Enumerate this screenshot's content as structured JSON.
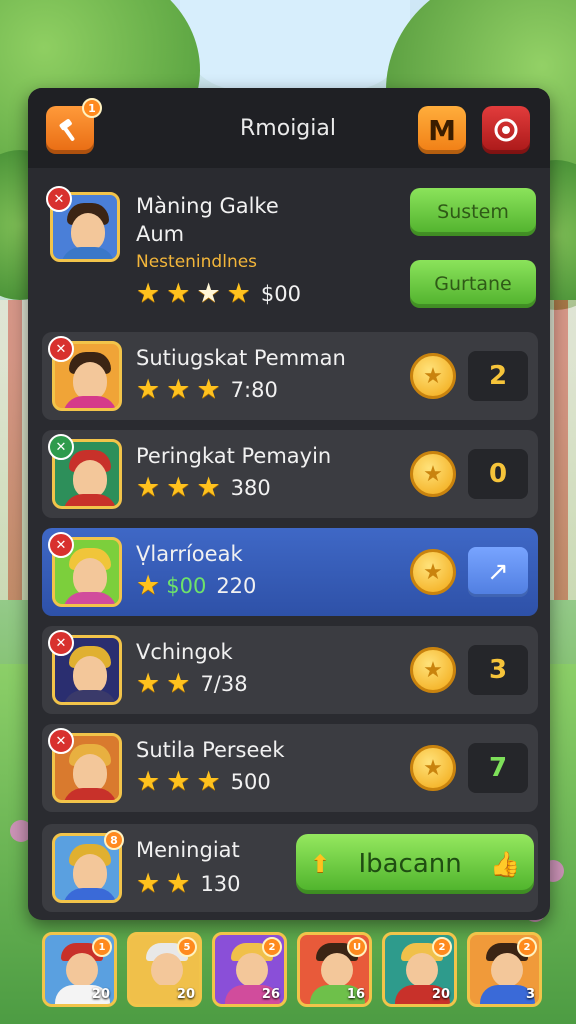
{
  "header": {
    "title": "Rmoigial",
    "left_icon": "hammer-icon",
    "left_badge": "1",
    "m_label": "M",
    "close_icon": "target-icon"
  },
  "top_player": {
    "name_line1": "Màning Galke",
    "name_line2": "Aum",
    "subtitle": "Nestenindlnes",
    "stars": 4,
    "score": "$00",
    "buttons": [
      "Sustem",
      "Gurtane"
    ]
  },
  "rows": [
    {
      "name": "Sutiugskat Pemman",
      "stars": 3,
      "score": "7:80",
      "count": "2",
      "count_color": "#f6c43a",
      "avatar_bg": "#f0a437",
      "hair": "#3b2414",
      "shirt": "#d53a8a",
      "highlight": false
    },
    {
      "name": "Peringkat Pemayin",
      "stars": 3,
      "score": "380",
      "count": "0",
      "count_color": "#f6c43a",
      "avatar_bg": "#2d8f5a",
      "hair": "#c8312a",
      "shirt": "#c8312a",
      "highlight": false
    },
    {
      "name": "Ṿlarríoeak",
      "stars": 1,
      "money": "$00",
      "score": "220",
      "count": "↗",
      "count_color": "#ffffff",
      "avatar_bg": "#7ccf3c",
      "hair": "#f0c53a",
      "shirt": "#d14c9c",
      "highlight": true
    },
    {
      "name": "Vchingok",
      "stars": 2,
      "score": "7/38",
      "count": "3",
      "count_color": "#f6c43a",
      "avatar_bg": "#2a2e70",
      "hair": "#e0b030",
      "shirt": "#3a3a6a",
      "highlight": false
    },
    {
      "name": "Sutila  Perseek",
      "stars": 3,
      "score": "500",
      "count": "7",
      "count_color": "#7ee05a",
      "avatar_bg": "#d97a2e",
      "hair": "#e8b040",
      "shirt": "#c8312a",
      "highlight": false
    }
  ],
  "bottom_player": {
    "name": "Meningiat",
    "stars": 2,
    "score": "130",
    "button_label": "Ibacann",
    "badge": "8"
  },
  "strip": [
    {
      "level": "20",
      "badge": "1",
      "bg": "#5aa0e0",
      "hat": "#c8312a",
      "shirt": "#f4f4f4"
    },
    {
      "level": "20",
      "badge": "5",
      "bg": "#f0c04a",
      "hat": "#e8e8e8",
      "shirt": "#f0c04a"
    },
    {
      "level": "26",
      "badge": "2",
      "bg": "#8a4fd8",
      "hat": "#f0c04a",
      "shirt": "#d14c9c"
    },
    {
      "level": "16",
      "badge": "U",
      "bg": "#e85a3a",
      "hat": "#3b2414",
      "shirt": "#6ec04a"
    },
    {
      "level": "20",
      "badge": "2",
      "bg": "#2e9b8c",
      "hat": "#f0c04a",
      "shirt": "#c8312a"
    },
    {
      "level": "3",
      "badge": "2",
      "bg": "#f09a3a",
      "hat": "#3b2414",
      "shirt": "#3a6ad8"
    }
  ]
}
